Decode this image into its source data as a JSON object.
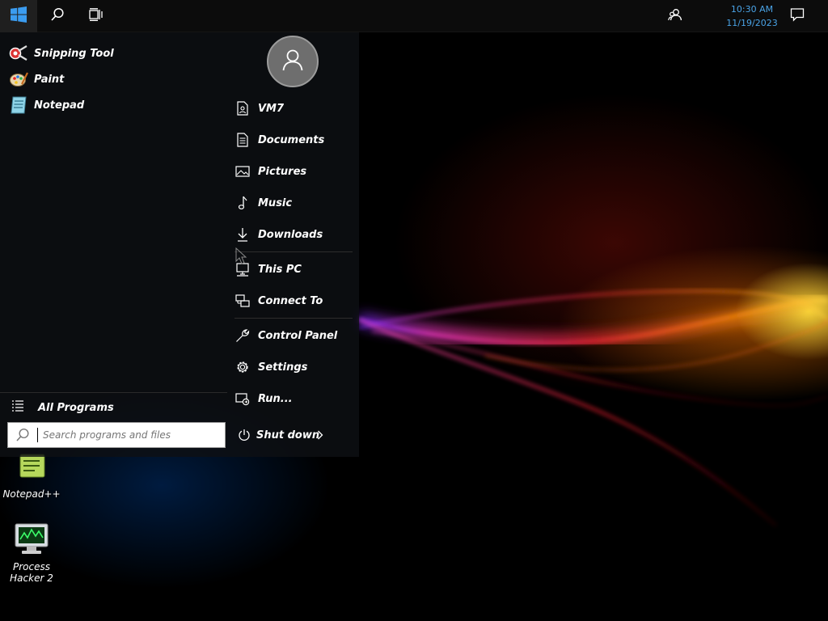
{
  "taskbar": {
    "start_icon": "windows-logo-icon",
    "search_icon": "search-icon",
    "taskview_icon": "task-view-icon",
    "people_icon": "people-icon",
    "clock_time": "10:30 AM",
    "clock_date": "11/19/2023",
    "notify_icon": "action-center-icon",
    "accent": "#4aa3e6"
  },
  "start_menu": {
    "pinned": [
      {
        "label": "Snipping Tool",
        "icon": "snipping-tool-icon"
      },
      {
        "label": "Paint",
        "icon": "paint-icon"
      },
      {
        "label": "Notepad",
        "icon": "notepad-icon"
      }
    ],
    "all_programs": "All Programs",
    "search_placeholder": "Search programs and files",
    "places": [
      {
        "label": "VM7",
        "icon": "user-folder-icon"
      },
      {
        "label": "Documents",
        "icon": "document-icon"
      },
      {
        "label": "Pictures",
        "icon": "picture-icon"
      },
      {
        "label": "Music",
        "icon": "music-icon"
      },
      {
        "label": "Downloads",
        "icon": "download-icon"
      },
      {
        "label": "This PC",
        "icon": "computer-icon"
      },
      {
        "label": "Connect To",
        "icon": "network-icon"
      },
      {
        "label": "Control Panel",
        "icon": "control-panel-icon"
      },
      {
        "label": "Settings",
        "icon": "gear-icon"
      },
      {
        "label": "Run...",
        "icon": "run-icon"
      }
    ],
    "shutdown_label": "Shut down"
  },
  "desktop": {
    "icons": [
      {
        "label": "Notepad++",
        "icon": "notepad-plus-plus-icon"
      },
      {
        "label": "Process Hacker 2",
        "icon": "process-hacker-icon"
      }
    ]
  }
}
